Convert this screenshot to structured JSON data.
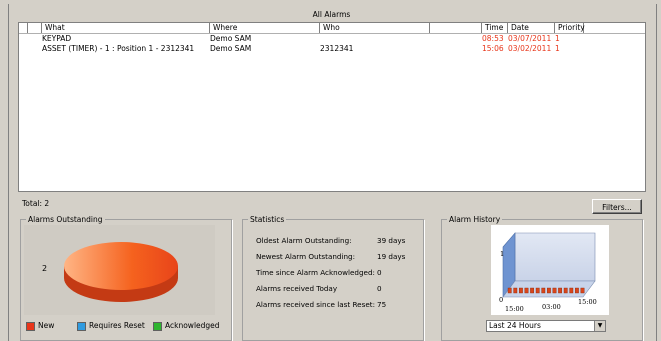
{
  "window": {
    "title": "All Alarms"
  },
  "alarm_table": {
    "columns": [
      "What",
      "Where",
      "Who",
      "",
      "Time",
      "Date",
      "Priority"
    ],
    "rows": [
      {
        "what": "KEYPAD",
        "where": "Demo SAM",
        "who": "",
        "time": "08:53",
        "date": "03/07/2011",
        "priority": "1"
      },
      {
        "what": "ASSET (TIMER)  - 1 : Position 1 - 2312341",
        "where": "Demo SAM",
        "who": "2312341",
        "time": "15:06",
        "date": "03/02/2011",
        "priority": "1"
      }
    ]
  },
  "footer": {
    "total_label": "Total: 2",
    "filters_label": "Filters..."
  },
  "alarms_outstanding": {
    "title": "Alarms Outstanding",
    "pie_count_label": "2",
    "legend": [
      {
        "label": "New",
        "color": "#e8351a"
      },
      {
        "label": "Requires Reset",
        "color": "#2f9be0"
      },
      {
        "label": "Acknowledged",
        "color": "#2fb52f"
      }
    ]
  },
  "statistics": {
    "title": "Statistics",
    "items": [
      {
        "label": "Oldest Alarm Outstanding:",
        "value": "39 days"
      },
      {
        "label": "Newest Alarm Outstanding:",
        "value": "19 days"
      },
      {
        "label": "Time since Alarm Acknowledged:",
        "value": "0"
      },
      {
        "label": "Alarms received Today",
        "value": "0"
      },
      {
        "label": "Alarms received since last Reset:",
        "value": "75"
      }
    ]
  },
  "alarm_history": {
    "title": "Alarm History",
    "y_top_label": "1",
    "y_zero_label": "0",
    "x_labels": [
      "15:00",
      "03:00",
      "15:00"
    ],
    "range_select": "Last 24 Hours"
  },
  "colors": {
    "pie_fill": "#f5521e",
    "history_wall": "#7a9fd4",
    "history_floor": "#c8d4ea",
    "history_bar": "#d9461c"
  }
}
